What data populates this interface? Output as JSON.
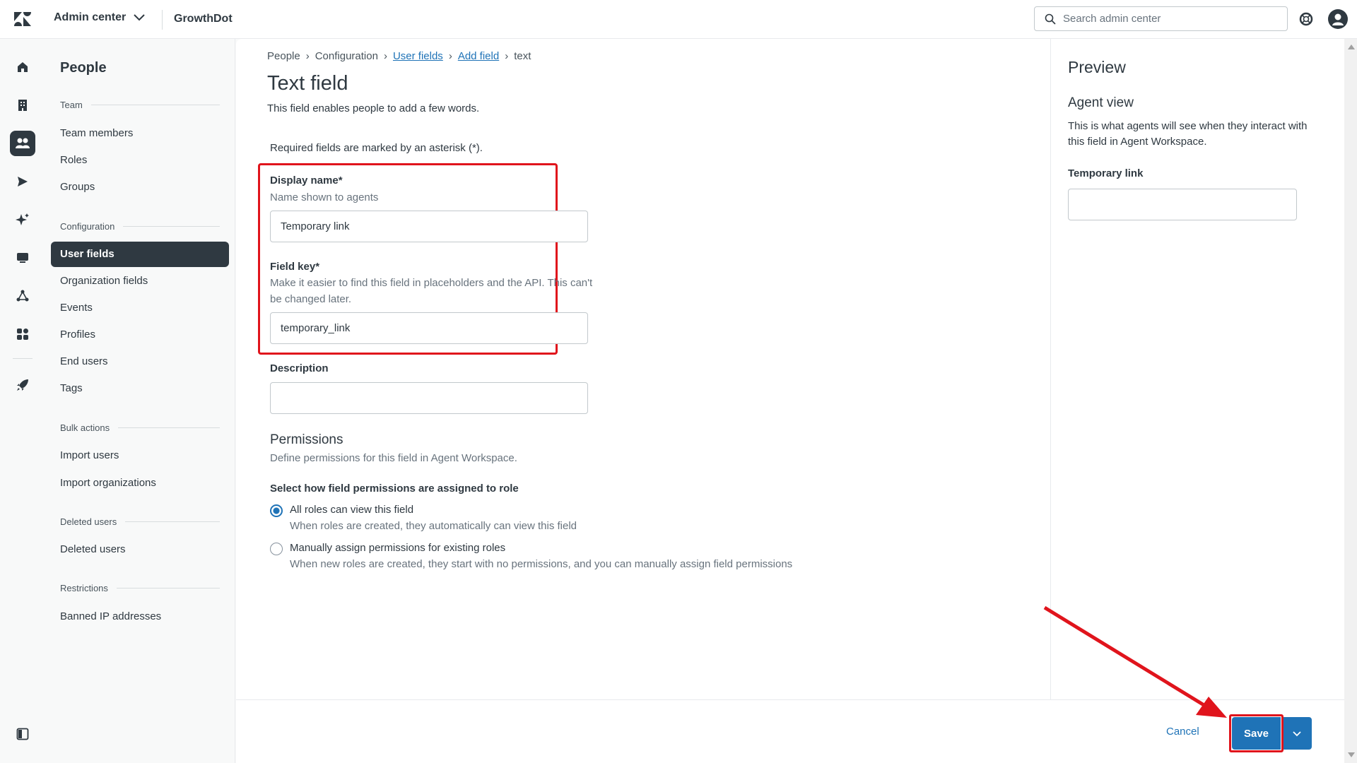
{
  "topbar": {
    "product": "Admin center",
    "account": "GrowthDot",
    "search_placeholder": "Search admin center"
  },
  "rail": {
    "icons": [
      "home-icon",
      "building-icon",
      "people-icon",
      "channels-icon",
      "ai-sparkle-icon",
      "workspaces-icon",
      "objects-rules-icon",
      "apps-icon",
      "rocket-icon",
      "panel-toggle-icon"
    ],
    "active": "people-icon"
  },
  "subnav": {
    "title": "People",
    "sections": [
      {
        "label": "Team",
        "items": [
          "Team members",
          "Roles",
          "Groups"
        ]
      },
      {
        "label": "Configuration",
        "items": [
          "User fields",
          "Organization fields",
          "Events",
          "Profiles",
          "End users",
          "Tags"
        ]
      },
      {
        "label": "Bulk actions",
        "items": [
          "Import users",
          "Import organizations"
        ]
      },
      {
        "label": "Deleted users",
        "items": [
          "Deleted users"
        ]
      },
      {
        "label": "Restrictions",
        "items": [
          "Banned IP addresses"
        ]
      }
    ],
    "active_item": "User fields"
  },
  "breadcrumb": {
    "people": "People",
    "configuration": "Configuration",
    "user_fields": "User fields",
    "add_field": "Add field",
    "current": "text"
  },
  "page": {
    "title": "Text field",
    "subtitle": "This field enables people to add a few words.",
    "required_note": "Required fields are marked by an asterisk (*)."
  },
  "form": {
    "display_name": {
      "label": "Display name*",
      "hint": "Name shown to agents",
      "value": "Temporary link"
    },
    "field_key": {
      "label": "Field key*",
      "hint": "Make it easier to find this field in placeholders and the API. This can't be changed later.",
      "value": "temporary_link"
    },
    "description": {
      "label": "Description",
      "value": ""
    }
  },
  "permissions": {
    "title": "Permissions",
    "subtitle": "Define permissions for this field in Agent Workspace.",
    "group_label": "Select how field permissions are assigned to role",
    "options": [
      {
        "label": "All roles can view this field",
        "hint": "When roles are created, they automatically can view this field",
        "checked": true
      },
      {
        "label": "Manually assign permissions for existing roles",
        "hint": "When new roles are created, they start with no permissions, and you can manually assign field permissions",
        "checked": false
      }
    ]
  },
  "preview": {
    "title": "Preview",
    "agent_view": "Agent view",
    "agent_desc": "This is what agents will see when they interact with this field in Agent Workspace.",
    "field_label": "Temporary link"
  },
  "footer": {
    "cancel": "Cancel",
    "save": "Save"
  },
  "colors": {
    "accent": "#1f73b7",
    "annotation": "#e0141c",
    "dark": "#2f3941"
  }
}
